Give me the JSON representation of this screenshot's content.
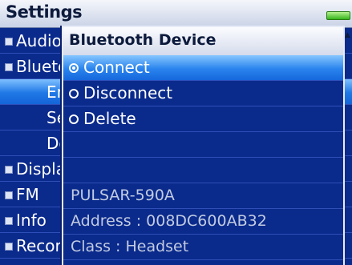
{
  "header": {
    "title": "Settings"
  },
  "settings_list": [
    {
      "label": "Audio",
      "level": 0,
      "bullet": true
    },
    {
      "label": "Bluetooth",
      "level": 0,
      "bullet": true
    },
    {
      "label": "Enable",
      "level": 1,
      "bullet": false,
      "highlighted": true
    },
    {
      "label": "Search",
      "level": 1,
      "bullet": false
    },
    {
      "label": "Device",
      "level": 1,
      "bullet": false
    },
    {
      "label": "Display",
      "level": 0,
      "bullet": true
    },
    {
      "label": "FM",
      "level": 0,
      "bullet": true
    },
    {
      "label": "Info",
      "level": 0,
      "bullet": true
    },
    {
      "label": "Record",
      "level": 0,
      "bullet": true
    }
  ],
  "popup": {
    "title": "Bluetooth Device",
    "options": [
      {
        "label": "Connect",
        "selected": true
      },
      {
        "label": "Disconnect",
        "selected": false
      },
      {
        "label": "Delete",
        "selected": false
      }
    ],
    "device_name": "PULSAR-590A",
    "address": "Address : 008DC600AB32",
    "device_class": "Class : Headset"
  },
  "colors": {
    "background": "#0a2a8c",
    "highlight": "#1f78e6",
    "battery": "#36b51c"
  },
  "icons": {
    "battery": "battery-icon",
    "bullet": "square-bullet-icon",
    "radio": "radio-icon"
  }
}
